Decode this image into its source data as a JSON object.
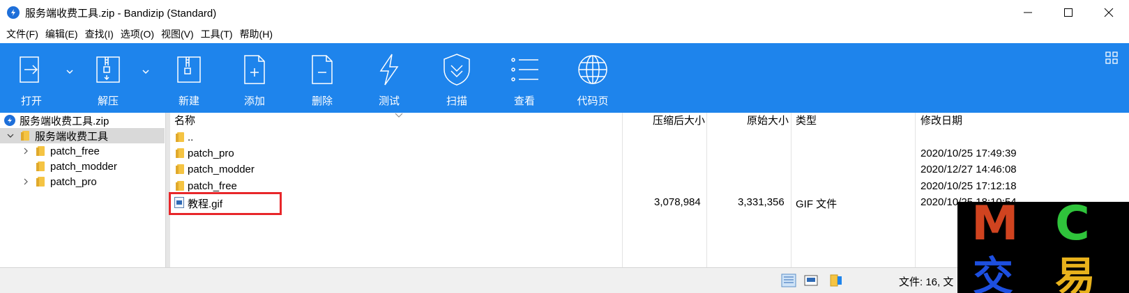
{
  "window": {
    "title": "服务端收费工具.zip - Bandizip (Standard)"
  },
  "menu": [
    "文件(F)",
    "编辑(E)",
    "查找(I)",
    "选项(O)",
    "视图(V)",
    "工具(T)",
    "帮助(H)"
  ],
  "toolbar": {
    "open": "打开",
    "extract": "解压",
    "new": "新建",
    "add": "添加",
    "delete": "删除",
    "test": "测试",
    "scan": "扫描",
    "view": "查看",
    "codepage": "代码页"
  },
  "tree": {
    "root": "服务端收费工具.zip",
    "folder": "服务端收费工具",
    "children": [
      "patch_free",
      "patch_modder",
      "patch_pro"
    ]
  },
  "columns": {
    "name": "名称",
    "compressed": "压缩后大小",
    "original": "原始大小",
    "type": "类型",
    "modified": "修改日期"
  },
  "files": [
    {
      "name": "..",
      "compressed": "",
      "original": "",
      "type": "",
      "modified": ""
    },
    {
      "name": "patch_pro",
      "compressed": "",
      "original": "",
      "type": "",
      "modified": "2020/10/25 17:49:39"
    },
    {
      "name": "patch_modder",
      "compressed": "",
      "original": "",
      "type": "",
      "modified": "2020/12/27 14:46:08"
    },
    {
      "name": "patch_free",
      "compressed": "",
      "original": "",
      "type": "",
      "modified": "2020/10/25 17:12:18"
    },
    {
      "name": "教程.gif",
      "compressed": "3,078,984",
      "original": "3,331,356",
      "type": "GIF 文件",
      "modified": "2020/10/25 18:10:54"
    }
  ],
  "status": {
    "text": "文件: 16, 文"
  },
  "watermark": {
    "letters": [
      "M",
      "C",
      "交",
      "易"
    ]
  },
  "colors": {
    "toolbar": "#1e84ec",
    "highlight": "#e8262a"
  }
}
